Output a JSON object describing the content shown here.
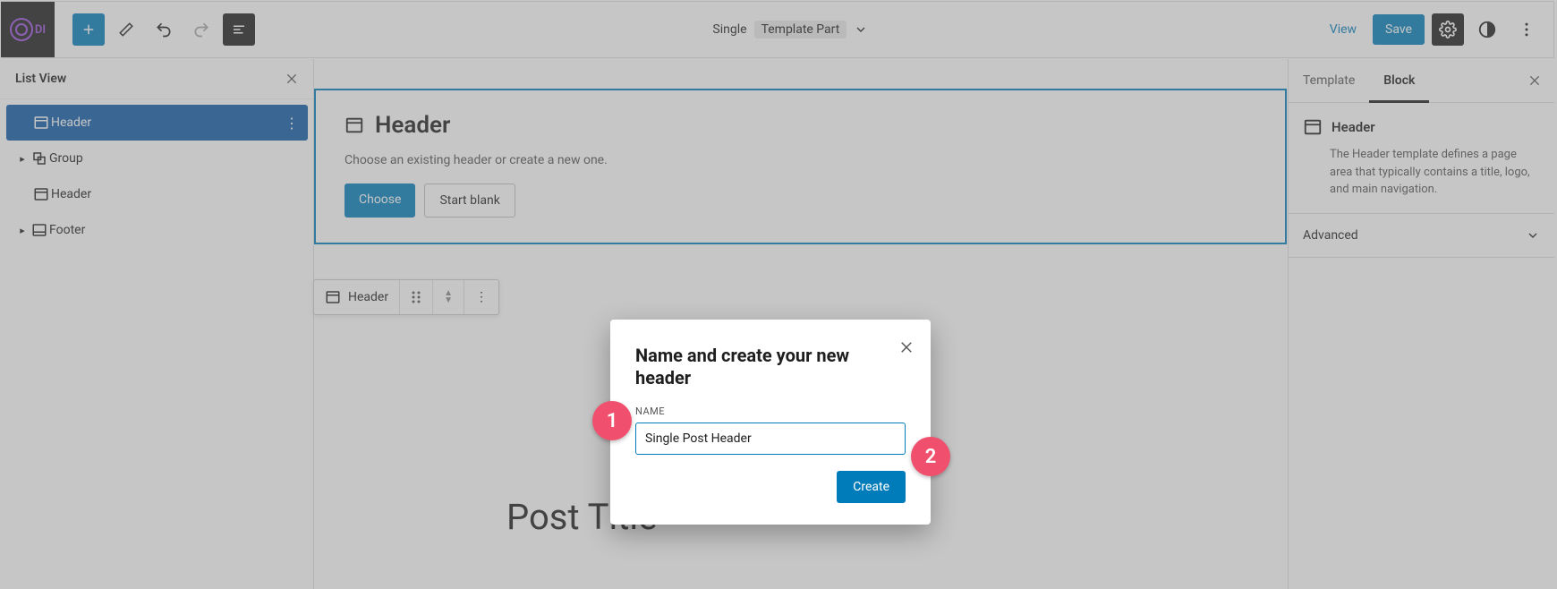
{
  "topbar": {
    "doc_type": "Single",
    "doc_part": "Template Part",
    "view": "View",
    "save": "Save"
  },
  "leftpanel": {
    "title": "List View",
    "items": [
      {
        "label": "Header",
        "selected": true,
        "exp": false,
        "more": true
      },
      {
        "label": "Group",
        "selected": false,
        "exp": true,
        "indent": 0
      },
      {
        "label": "Header",
        "selected": false,
        "exp": false,
        "indent": 0
      },
      {
        "label": "Footer",
        "selected": false,
        "exp": true,
        "indent": 0
      }
    ]
  },
  "card": {
    "title": "Header",
    "subtitle": "Choose an existing header or create a new one.",
    "choose": "Choose",
    "blank": "Start blank"
  },
  "mini": {
    "label": "Header"
  },
  "post_title": "Post Title",
  "rightpanel": {
    "tabs": {
      "template": "Template",
      "block": "Block"
    },
    "block_name": "Header",
    "block_desc": "The Header template defines a page area that typically contains a title, logo, and main navigation.",
    "advanced": "Advanced"
  },
  "modal": {
    "title": "Name and create your new header",
    "label": "NAME",
    "value": "Single Post Header",
    "create": "Create"
  },
  "badges": {
    "one": "1",
    "two": "2"
  }
}
